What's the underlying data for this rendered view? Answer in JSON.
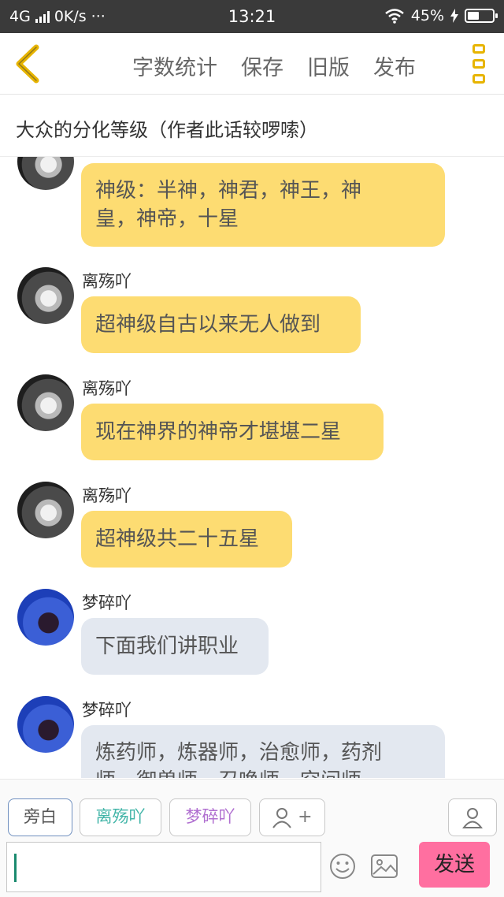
{
  "status_bar": {
    "network": "4G",
    "speed": "0K/s",
    "dots": "···",
    "time": "13:21",
    "battery": "45%"
  },
  "toolbar": {
    "word_count": "字数统计",
    "save": "保存",
    "old_version": "旧版",
    "publish": "发布"
  },
  "chapter_title": "大众的分化等级（作者此话较啰嗦）",
  "messages": [
    {
      "sender": "",
      "avatar": "bw",
      "lines": [
        "神级：半神，神君，神王，神",
        "皇，神帝，十星"
      ]
    },
    {
      "sender": "离殇吖",
      "avatar": "bw",
      "lines": [
        "超神级自古以来无人做到"
      ]
    },
    {
      "sender": "离殇吖",
      "avatar": "bw",
      "lines": [
        "现在神界的神帝才堪堪二星"
      ]
    },
    {
      "sender": "离殇吖",
      "avatar": "bw",
      "lines": [
        "超神级共二十五星"
      ]
    },
    {
      "sender": "梦碎吖",
      "avatar": "blue",
      "lines": [
        "下面我们讲职业"
      ]
    },
    {
      "sender": "梦碎吖",
      "avatar": "blue",
      "lines": [
        "炼药师，炼器师，治愈师，药剂",
        "师，御兽师，召唤师，空间师，"
      ]
    }
  ],
  "roles": {
    "narrator": "旁白",
    "role1": "离殇吖",
    "role2": "梦碎吖",
    "add_role": "+"
  },
  "input": {
    "placeholder": "",
    "send": "发送"
  },
  "colors": {
    "bubble_yellow": "#fddc72",
    "bubble_grey": "#e3e8f0",
    "send_button": "#ff6fa0",
    "accent": "#e7b400"
  }
}
